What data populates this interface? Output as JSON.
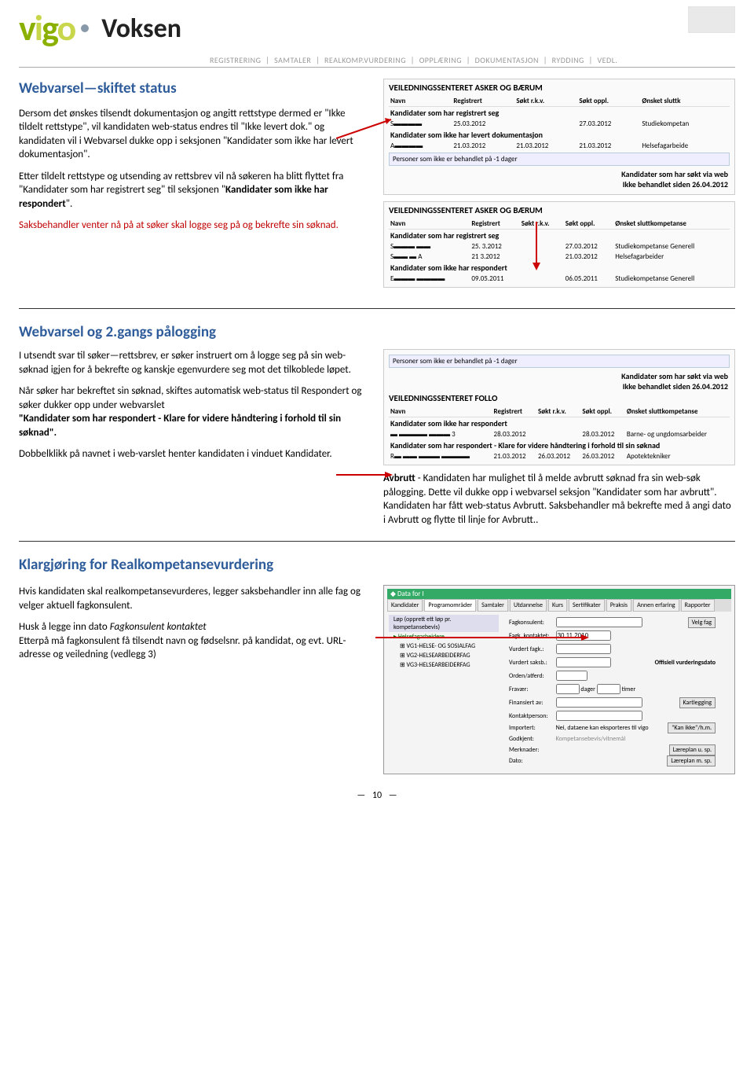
{
  "header": {
    "logo_text": "vigo",
    "voksen_text": "Voksen",
    "breadcrumb": [
      "REGISTRERING",
      "SAMTALER",
      "REALKOMP.VURDERING",
      "OPPLÆRING",
      "DOKUMENTASJON",
      "RYDDING",
      "VEDL."
    ]
  },
  "section1": {
    "title": "Webvarsel—skiftet status",
    "p1": "Dersom det ønskes tilsendt dokumentasjon og angitt rettstype dermed er \"Ikke tildelt rettstype\", vil kandidaten web-status endres til \"Ikke levert dok.\" og kandidaten vil i Webvarsel dukke opp i seksjonen \"Kandidater som ikke har levert dokumentasjon\".",
    "p2a": "Etter tildelt rettstype og utsending av rettsbrev vil nå søkeren ha blitt flyttet fra \"Kandidater som har registrert seg\" til  seksjonen \"",
    "p2b": "Kandidater som ikke har respondert",
    "p2c": "\".",
    "p3": "Saksbehandler venter nå på at søker skal logge seg på og bekrefte sin søknad.",
    "app1": {
      "title": "VEILEDNINGSSENTERET ASKER OG BÆRUM",
      "cols": [
        "Navn",
        "Registrert",
        "Søkt r.k.v.",
        "Søkt oppl.",
        "Ønsket sluttk"
      ],
      "row_hdr1": "Kandidater som har registrert seg",
      "row1": [
        "S▬▬▬▬",
        "25.03.2012",
        "",
        "27.03.2012",
        "Studiekompetan"
      ],
      "row_hdr2": "Kandidater som ikke har levert dokumentasjon",
      "row2": [
        "A▬▬▬▬",
        "21.03.2012",
        "21.03.2012",
        "21.03.2012",
        "Helsefagarbeide"
      ],
      "banner": "Personer som ikke er behandlet på -1 dager",
      "note1": "Kandidater som har søkt via web",
      "note2": "Ikke behandlet siden 26.04.2012"
    },
    "app2": {
      "title": "VEILEDNINGSSENTERET ASKER OG BÆRUM",
      "cols": [
        "Navn",
        "Registrert",
        "Søkt r.k.v.",
        "Søkt oppl.",
        "Ønsket sluttkompetanse"
      ],
      "row_hdr1": "Kandidater som har registrert seg",
      "row1": [
        "S▬▬▬ ▬▬",
        "25. 3.2012",
        "",
        "27.03.2012",
        "Studiekompetanse Generell"
      ],
      "row2": [
        "S▬▬ ▬ A",
        "21  3.2012",
        "",
        "21.03.2012",
        "Helsefagarbeider"
      ],
      "row_hdr2": "Kandidater som ikke har respondert",
      "row3": [
        "E▬▬▬  ▬▬▬▬",
        "09.05.2011",
        "",
        "06.05.2011",
        "Studiekompetanse Generell"
      ]
    }
  },
  "section2": {
    "title": "Webvarsel og 2.gangs pålogging",
    "p1": "I utsendt svar til søker—rettsbrev, er søker instruert om å logge seg på sin web-søknad igjen for å bekrefte og kanskje egenvurdere seg mot det tilkoblede løpet.",
    "p2a": "Når søker har bekreftet sin søknad, skiftes automatisk web-status til Respondert og søker dukker opp under webvarslet",
    "p2b": "\"Kandidater som har respondert - Klare for videre håndtering i forhold til sin søknad\".",
    "p3": "Dobbelklikk på navnet i web-varslet henter kandidaten i vinduet Kandidater.",
    "app": {
      "banner": "Personer som ikke er behandlet på -1 dager",
      "note1": "Kandidater som har søkt via web",
      "note2": "Ikke behandlet siden 26.04.2012",
      "title": "VEILEDNINGSSENTERET FOLLO",
      "cols": [
        "Navn",
        "Registrert",
        "Søkt r.k.v.",
        "Søkt oppl.",
        "Ønsket sluttkompetanse"
      ],
      "row_hdr1": "Kandidater som ikke har respondert",
      "row1": [
        "▬ ▬▬▬▬ ▬▬▬  3",
        "28.03.2012",
        "",
        "28.03.2012",
        "Barne- og ungdomsarbeider"
      ],
      "row_hdr2": "Kandidater som har respondert - Klare for videre håndtering i forhold til sin søknad",
      "row2": [
        "R▬ ▬▬ ▬▬▬ ▬▬▬▬",
        "21.03.2012",
        "26.03.2012",
        "26.03.2012",
        "Apotektekniker"
      ]
    },
    "avbrutt_b": "Avbrutt",
    "avbrutt": " - Kandidaten har mulighet til å melde avbrutt søknad fra sin web-søk pålogging. Dette vil dukke opp i webvarsel seksjon \"Kandidater som har avbrutt\". Kandidaten har fått web-status Avbrutt. Saksbehandler må bekrefte med å angi dato i Avbrutt og flytte til linje for Avbrutt.."
  },
  "section3": {
    "title": "Klargjøring for Realkompetansevurdering",
    "p1": "Hvis kandidaten skal realkompetansevurderes, legger saksbehandler inn alle fag og velger aktuell fagkonsulent.",
    "p2a": "Husk å legge inn dato ",
    "p2b": "Fagkonsulent kontaktet",
    "p2c": "Etterpå må fagkonsulent få tilsendt navn og fødselsnr. på kandidat, og evt. URL-adresse og veiledning (vedlegg 3)",
    "form": {
      "win_title": "Data for I",
      "tabs": [
        "Kandidater",
        "Programområder",
        "Samtaler",
        "Utdannelse",
        "Kurs",
        "Sertifikater",
        "Praksis",
        "Annen erfaring",
        "Rapporter"
      ],
      "tree_root": "Løp (opprett ett løp pr. kompetansebevis)",
      "tree_items": [
        "Helsefagarbeidere",
        "VG1-HELSE- OG SOSIALFAG",
        "VG2-HELSEARBEIDERFAG",
        "VG3-HELSEARBEIDERFAG"
      ],
      "fields": {
        "fagkonsulent": "Fagkonsulent:",
        "fagk_kontaktet": "Fagk. kontaktet:",
        "fagk_kontaktet_val": "30.11.2010",
        "vurdert_fagk": "Vurdert fagk.:",
        "vurdert_saksb": "Vurdert saksb.:",
        "off_dato": "Offisiell vurderingsdato",
        "orden": "Orden/atferd:",
        "fravaer": "Fravær:",
        "dager": "dager",
        "timer": "timer",
        "finansiert": "Finansiert av:",
        "kontakt": "Kontaktperson:",
        "importert": "Importert:",
        "importert_val": "Nei, dataene kan eksporteres til vigo",
        "godkjent": "Godkjent:",
        "kompbev": "Kompetansebevis/vitnemål",
        "merknader": "Merknader:",
        "dato": "Dato:"
      },
      "btns": {
        "velg_fag": "Velg fag",
        "kartlegging": "Kartlegging",
        "kan_ikke": "\"Kan ikke\"/h.m.",
        "laereplan_u": "Læreplan u. sp.",
        "laereplan_m": "Læreplan m. sp."
      }
    }
  },
  "page_num": "10"
}
